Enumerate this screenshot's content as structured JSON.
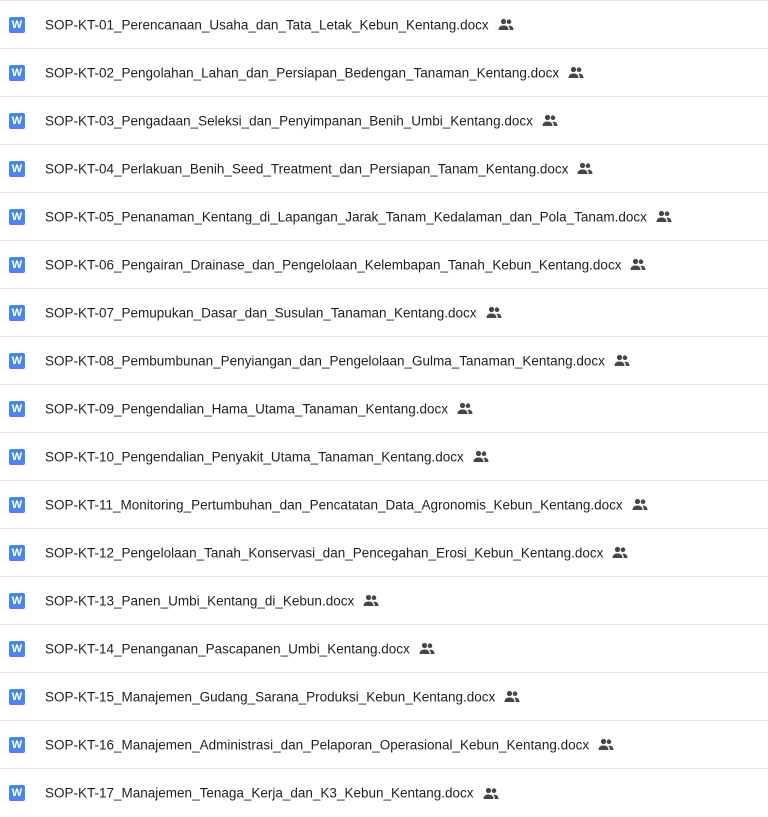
{
  "colors": {
    "word_icon_bg": "#4a86e8",
    "text": "#1f1f1f",
    "shared_icon": "#444746",
    "divider": "#e0e0e0"
  },
  "files": [
    {
      "name": "SOP-KT-01_Perencanaan_Usaha_dan_Tata_Letak_Kebun_Kentang.docx",
      "icon": "word-icon",
      "icon_letter": "W",
      "shared": "shared-people-icon"
    },
    {
      "name": "SOP-KT-02_Pengolahan_Lahan_dan_Persiapan_Bedengan_Tanaman_Kentang.docx",
      "icon": "word-icon",
      "icon_letter": "W",
      "shared": "shared-people-icon"
    },
    {
      "name": "SOP-KT-03_Pengadaan_Seleksi_dan_Penyimpanan_Benih_Umbi_Kentang.docx",
      "icon": "word-icon",
      "icon_letter": "W",
      "shared": "shared-people-icon"
    },
    {
      "name": "SOP-KT-04_Perlakuan_Benih_Seed_Treatment_dan_Persiapan_Tanam_Kentang.docx",
      "icon": "word-icon",
      "icon_letter": "W",
      "shared": "shared-people-icon"
    },
    {
      "name": "SOP-KT-05_Penanaman_Kentang_di_Lapangan_Jarak_Tanam_Kedalaman_dan_Pola_Tanam.docx",
      "icon": "word-icon",
      "icon_letter": "W",
      "shared": "shared-people-icon"
    },
    {
      "name": "SOP-KT-06_Pengairan_Drainase_dan_Pengelolaan_Kelembapan_Tanah_Kebun_Kentang.docx",
      "icon": "word-icon",
      "icon_letter": "W",
      "shared": "shared-people-icon"
    },
    {
      "name": "SOP-KT-07_Pemupukan_Dasar_dan_Susulan_Tanaman_Kentang.docx",
      "icon": "word-icon",
      "icon_letter": "W",
      "shared": "shared-people-icon"
    },
    {
      "name": "SOP-KT-08_Pembumbunan_Penyiangan_dan_Pengelolaan_Gulma_Tanaman_Kentang.docx",
      "icon": "word-icon",
      "icon_letter": "W",
      "shared": "shared-people-icon"
    },
    {
      "name": "SOP-KT-09_Pengendalian_Hama_Utama_Tanaman_Kentang.docx",
      "icon": "word-icon",
      "icon_letter": "W",
      "shared": "shared-people-icon"
    },
    {
      "name": "SOP-KT-10_Pengendalian_Penyakit_Utama_Tanaman_Kentang.docx",
      "icon": "word-icon",
      "icon_letter": "W",
      "shared": "shared-people-icon"
    },
    {
      "name": "SOP-KT-11_Monitoring_Pertumbuhan_dan_Pencatatan_Data_Agronomis_Kebun_Kentang.docx",
      "icon": "word-icon",
      "icon_letter": "W",
      "shared": "shared-people-icon"
    },
    {
      "name": "SOP-KT-12_Pengelolaan_Tanah_Konservasi_dan_Pencegahan_Erosi_Kebun_Kentang.docx",
      "icon": "word-icon",
      "icon_letter": "W",
      "shared": "shared-people-icon"
    },
    {
      "name": "SOP-KT-13_Panen_Umbi_Kentang_di_Kebun.docx",
      "icon": "word-icon",
      "icon_letter": "W",
      "shared": "shared-people-icon"
    },
    {
      "name": "SOP-KT-14_Penanganan_Pascapanen_Umbi_Kentang.docx",
      "icon": "word-icon",
      "icon_letter": "W",
      "shared": "shared-people-icon"
    },
    {
      "name": "SOP-KT-15_Manajemen_Gudang_Sarana_Produksi_Kebun_Kentang.docx",
      "icon": "word-icon",
      "icon_letter": "W",
      "shared": "shared-people-icon"
    },
    {
      "name": "SOP-KT-16_Manajemen_Administrasi_dan_Pelaporan_Operasional_Kebun_Kentang.docx",
      "icon": "word-icon",
      "icon_letter": "W",
      "shared": "shared-people-icon"
    },
    {
      "name": "SOP-KT-17_Manajemen_Tenaga_Kerja_dan_K3_Kebun_Kentang.docx",
      "icon": "word-icon",
      "icon_letter": "W",
      "shared": "shared-people-icon"
    }
  ]
}
